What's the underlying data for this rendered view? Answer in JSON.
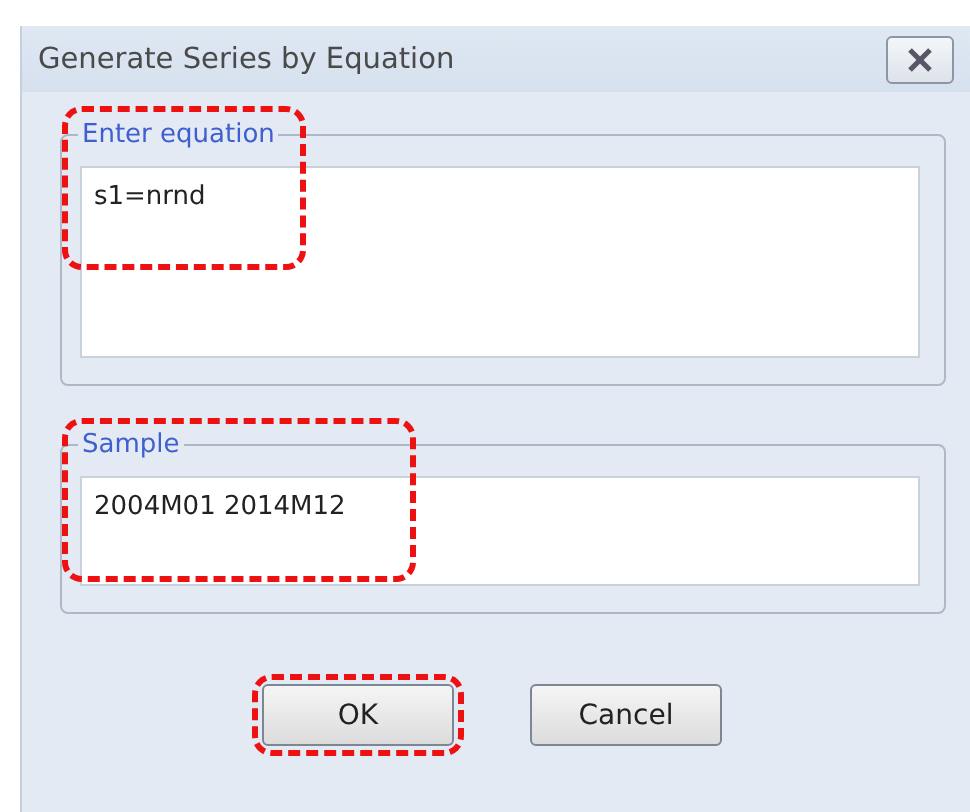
{
  "window": {
    "title": "Generate Series by Equation"
  },
  "groups": [
    {
      "legend": "Enter equation",
      "value": "s1=nrnd",
      "highlighted": true,
      "kind": "multiline"
    },
    {
      "legend": "Sample",
      "value": "2004M01 2014M12",
      "highlighted": true,
      "kind": "single"
    }
  ],
  "buttons": [
    {
      "label": "OK",
      "highlighted": true
    },
    {
      "label": "Cancel",
      "highlighted": false
    }
  ]
}
